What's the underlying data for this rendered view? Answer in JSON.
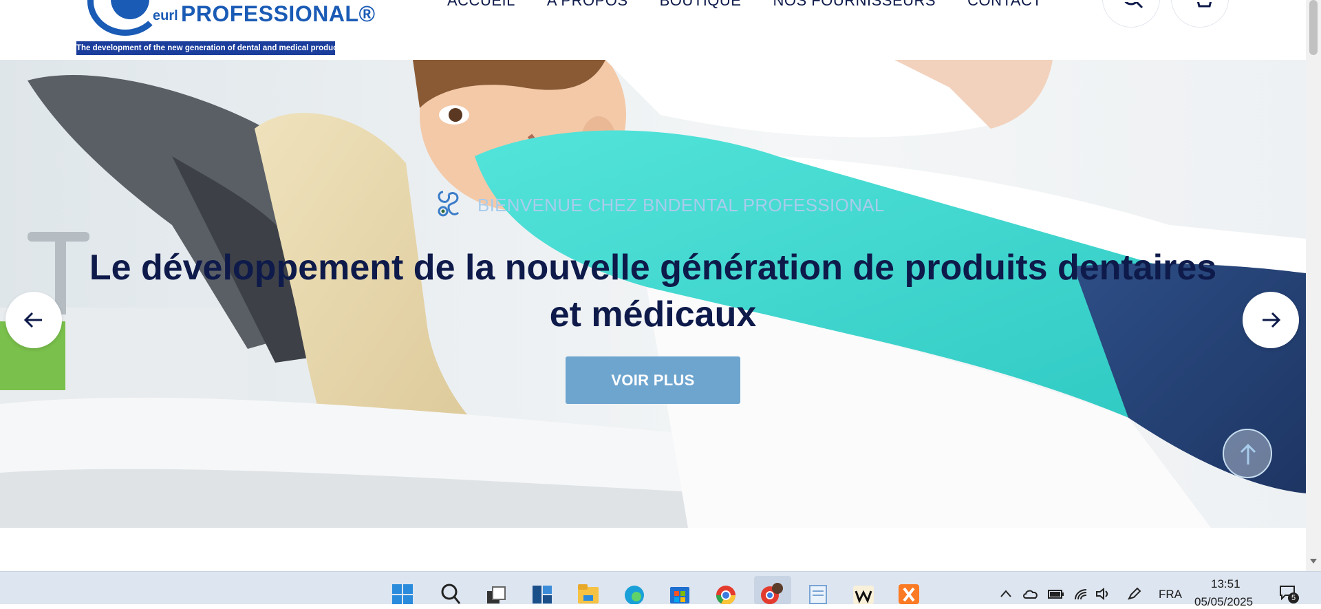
{
  "header": {
    "logo": {
      "brand_prefix": "eurl",
      "brand_name": "PROFESSIONAL®",
      "tagline": "The development of the new generation of dental and medical products"
    },
    "nav": [
      {
        "label": "ACCUEIL"
      },
      {
        "label": "A PROPOS"
      },
      {
        "label": "BOUTIQUE"
      },
      {
        "label": "NOS FOURNISSEURS"
      },
      {
        "label": "CONTACT"
      }
    ],
    "buttons": [
      {
        "icon": "search-icon"
      },
      {
        "icon": "cart-icon"
      }
    ]
  },
  "hero": {
    "welcome": "BIENVENUE CHEZ BNDENTAL PROFESSIONAL",
    "welcome_icon": "stethoscope-icon",
    "headline_line1": "Le développement de la nouvelle génération de produits dentaires",
    "headline_line2": "et médicaux",
    "cta_label": "VOIR PLUS",
    "prev_icon": "arrow-left-icon",
    "next_icon": "arrow-right-icon",
    "scroll_top_icon": "arrow-up-icon"
  },
  "colors": {
    "navy": "#0e1a4a",
    "brand_blue": "#1a5bb5",
    "cta": "#6ea5cf",
    "welcome": "#a9ccec",
    "taskbar": "#dde5f0"
  },
  "taskbar": {
    "apps": [
      {
        "name": "start-icon"
      },
      {
        "name": "search-icon"
      },
      {
        "name": "task-view-icon"
      },
      {
        "name": "widgets-icon"
      },
      {
        "name": "file-explorer-icon"
      },
      {
        "name": "edge-icon"
      },
      {
        "name": "store-icon"
      },
      {
        "name": "chrome-icon"
      },
      {
        "name": "chrome-profile-icon"
      },
      {
        "name": "notepad-icon"
      },
      {
        "name": "w-app-icon"
      },
      {
        "name": "xampp-icon"
      }
    ],
    "language": "FRA",
    "time": "13:51",
    "date": "05/05/2025",
    "notification_count": "5"
  }
}
